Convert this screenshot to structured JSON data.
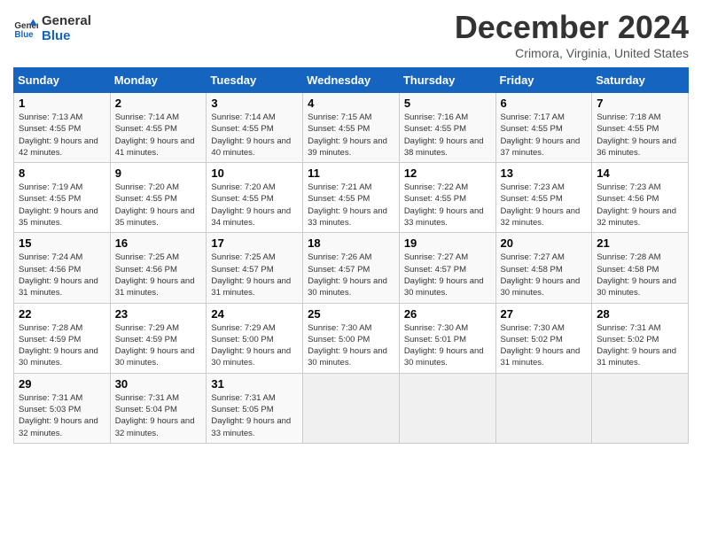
{
  "header": {
    "logo_general": "General",
    "logo_blue": "Blue",
    "month_year": "December 2024",
    "location": "Crimora, Virginia, United States"
  },
  "weekdays": [
    "Sunday",
    "Monday",
    "Tuesday",
    "Wednesday",
    "Thursday",
    "Friday",
    "Saturday"
  ],
  "weeks": [
    [
      {
        "day": "1",
        "sunrise": "Sunrise: 7:13 AM",
        "sunset": "Sunset: 4:55 PM",
        "daylight": "Daylight: 9 hours and 42 minutes."
      },
      {
        "day": "2",
        "sunrise": "Sunrise: 7:14 AM",
        "sunset": "Sunset: 4:55 PM",
        "daylight": "Daylight: 9 hours and 41 minutes."
      },
      {
        "day": "3",
        "sunrise": "Sunrise: 7:14 AM",
        "sunset": "Sunset: 4:55 PM",
        "daylight": "Daylight: 9 hours and 40 minutes."
      },
      {
        "day": "4",
        "sunrise": "Sunrise: 7:15 AM",
        "sunset": "Sunset: 4:55 PM",
        "daylight": "Daylight: 9 hours and 39 minutes."
      },
      {
        "day": "5",
        "sunrise": "Sunrise: 7:16 AM",
        "sunset": "Sunset: 4:55 PM",
        "daylight": "Daylight: 9 hours and 38 minutes."
      },
      {
        "day": "6",
        "sunrise": "Sunrise: 7:17 AM",
        "sunset": "Sunset: 4:55 PM",
        "daylight": "Daylight: 9 hours and 37 minutes."
      },
      {
        "day": "7",
        "sunrise": "Sunrise: 7:18 AM",
        "sunset": "Sunset: 4:55 PM",
        "daylight": "Daylight: 9 hours and 36 minutes."
      }
    ],
    [
      {
        "day": "8",
        "sunrise": "Sunrise: 7:19 AM",
        "sunset": "Sunset: 4:55 PM",
        "daylight": "Daylight: 9 hours and 35 minutes."
      },
      {
        "day": "9",
        "sunrise": "Sunrise: 7:20 AM",
        "sunset": "Sunset: 4:55 PM",
        "daylight": "Daylight: 9 hours and 35 minutes."
      },
      {
        "day": "10",
        "sunrise": "Sunrise: 7:20 AM",
        "sunset": "Sunset: 4:55 PM",
        "daylight": "Daylight: 9 hours and 34 minutes."
      },
      {
        "day": "11",
        "sunrise": "Sunrise: 7:21 AM",
        "sunset": "Sunset: 4:55 PM",
        "daylight": "Daylight: 9 hours and 33 minutes."
      },
      {
        "day": "12",
        "sunrise": "Sunrise: 7:22 AM",
        "sunset": "Sunset: 4:55 PM",
        "daylight": "Daylight: 9 hours and 33 minutes."
      },
      {
        "day": "13",
        "sunrise": "Sunrise: 7:23 AM",
        "sunset": "Sunset: 4:55 PM",
        "daylight": "Daylight: 9 hours and 32 minutes."
      },
      {
        "day": "14",
        "sunrise": "Sunrise: 7:23 AM",
        "sunset": "Sunset: 4:56 PM",
        "daylight": "Daylight: 9 hours and 32 minutes."
      }
    ],
    [
      {
        "day": "15",
        "sunrise": "Sunrise: 7:24 AM",
        "sunset": "Sunset: 4:56 PM",
        "daylight": "Daylight: 9 hours and 31 minutes."
      },
      {
        "day": "16",
        "sunrise": "Sunrise: 7:25 AM",
        "sunset": "Sunset: 4:56 PM",
        "daylight": "Daylight: 9 hours and 31 minutes."
      },
      {
        "day": "17",
        "sunrise": "Sunrise: 7:25 AM",
        "sunset": "Sunset: 4:57 PM",
        "daylight": "Daylight: 9 hours and 31 minutes."
      },
      {
        "day": "18",
        "sunrise": "Sunrise: 7:26 AM",
        "sunset": "Sunset: 4:57 PM",
        "daylight": "Daylight: 9 hours and 30 minutes."
      },
      {
        "day": "19",
        "sunrise": "Sunrise: 7:27 AM",
        "sunset": "Sunset: 4:57 PM",
        "daylight": "Daylight: 9 hours and 30 minutes."
      },
      {
        "day": "20",
        "sunrise": "Sunrise: 7:27 AM",
        "sunset": "Sunset: 4:58 PM",
        "daylight": "Daylight: 9 hours and 30 minutes."
      },
      {
        "day": "21",
        "sunrise": "Sunrise: 7:28 AM",
        "sunset": "Sunset: 4:58 PM",
        "daylight": "Daylight: 9 hours and 30 minutes."
      }
    ],
    [
      {
        "day": "22",
        "sunrise": "Sunrise: 7:28 AM",
        "sunset": "Sunset: 4:59 PM",
        "daylight": "Daylight: 9 hours and 30 minutes."
      },
      {
        "day": "23",
        "sunrise": "Sunrise: 7:29 AM",
        "sunset": "Sunset: 4:59 PM",
        "daylight": "Daylight: 9 hours and 30 minutes."
      },
      {
        "day": "24",
        "sunrise": "Sunrise: 7:29 AM",
        "sunset": "Sunset: 5:00 PM",
        "daylight": "Daylight: 9 hours and 30 minutes."
      },
      {
        "day": "25",
        "sunrise": "Sunrise: 7:30 AM",
        "sunset": "Sunset: 5:00 PM",
        "daylight": "Daylight: 9 hours and 30 minutes."
      },
      {
        "day": "26",
        "sunrise": "Sunrise: 7:30 AM",
        "sunset": "Sunset: 5:01 PM",
        "daylight": "Daylight: 9 hours and 30 minutes."
      },
      {
        "day": "27",
        "sunrise": "Sunrise: 7:30 AM",
        "sunset": "Sunset: 5:02 PM",
        "daylight": "Daylight: 9 hours and 31 minutes."
      },
      {
        "day": "28",
        "sunrise": "Sunrise: 7:31 AM",
        "sunset": "Sunset: 5:02 PM",
        "daylight": "Daylight: 9 hours and 31 minutes."
      }
    ],
    [
      {
        "day": "29",
        "sunrise": "Sunrise: 7:31 AM",
        "sunset": "Sunset: 5:03 PM",
        "daylight": "Daylight: 9 hours and 32 minutes."
      },
      {
        "day": "30",
        "sunrise": "Sunrise: 7:31 AM",
        "sunset": "Sunset: 5:04 PM",
        "daylight": "Daylight: 9 hours and 32 minutes."
      },
      {
        "day": "31",
        "sunrise": "Sunrise: 7:31 AM",
        "sunset": "Sunset: 5:05 PM",
        "daylight": "Daylight: 9 hours and 33 minutes."
      },
      null,
      null,
      null,
      null
    ]
  ]
}
